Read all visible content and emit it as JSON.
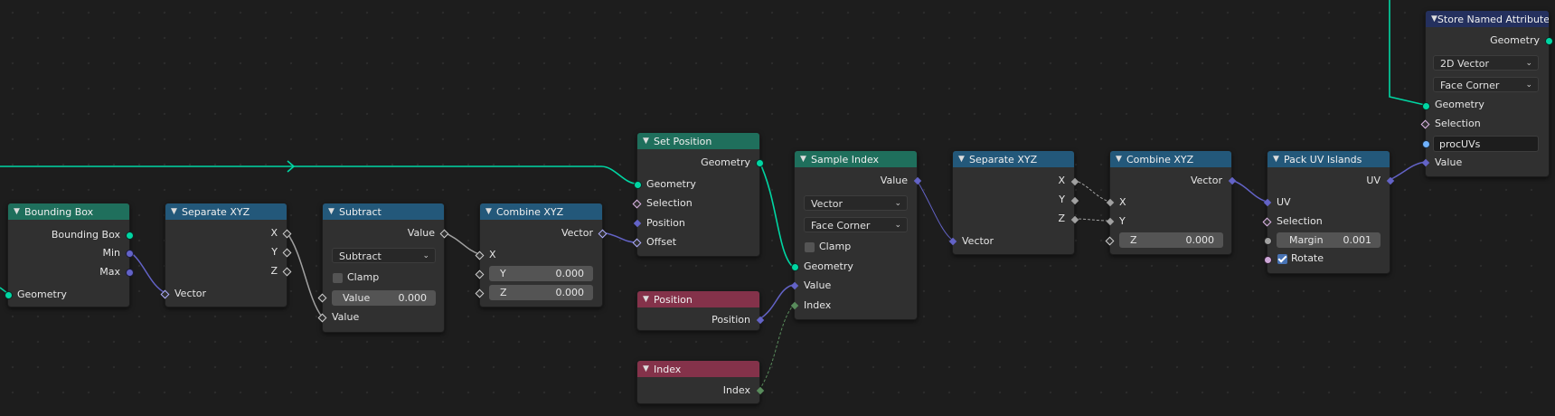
{
  "nodes": {
    "bounding_box": {
      "title": "Bounding Box",
      "out_box": "Bounding Box",
      "out_min": "Min",
      "out_max": "Max",
      "in_geometry": "Geometry"
    },
    "separate_xyz_1": {
      "title": "Separate XYZ",
      "out_x": "X",
      "out_y": "Y",
      "out_z": "Z",
      "in_vector": "Vector"
    },
    "subtract": {
      "title": "Subtract",
      "out_value": "Value",
      "mode": "Subtract",
      "clamp_label": "Clamp",
      "clamp_checked": false,
      "value_label": "Value",
      "value": "0.000",
      "in_value": "Value"
    },
    "combine_xyz_1": {
      "title": "Combine XYZ",
      "out_vector": "Vector",
      "in_x": "X",
      "y_label": "Y",
      "y_value": "0.000",
      "z_label": "Z",
      "z_value": "0.000"
    },
    "set_position": {
      "title": "Set Position",
      "out_geometry": "Geometry",
      "in_geometry": "Geometry",
      "in_selection": "Selection",
      "in_position": "Position",
      "in_offset": "Offset"
    },
    "position": {
      "title": "Position",
      "out_position": "Position"
    },
    "index": {
      "title": "Index",
      "out_index": "Index"
    },
    "sample_index": {
      "title": "Sample Index",
      "out_value": "Value",
      "data_type": "Vector",
      "domain": "Face Corner",
      "clamp_label": "Clamp",
      "clamp_checked": false,
      "in_geometry": "Geometry",
      "in_value": "Value",
      "in_index": "Index"
    },
    "separate_xyz_2": {
      "title": "Separate XYZ",
      "out_x": "X",
      "out_y": "Y",
      "out_z": "Z",
      "in_vector": "Vector"
    },
    "combine_xyz_2": {
      "title": "Combine XYZ",
      "out_vector": "Vector",
      "in_x": "X",
      "in_y": "Y",
      "z_label": "Z",
      "z_value": "0.000"
    },
    "pack_uv_islands": {
      "title": "Pack UV Islands",
      "out_uv": "UV",
      "in_uv": "UV",
      "in_selection": "Selection",
      "margin_label": "Margin",
      "margin_value": "0.001",
      "rotate_label": "Rotate",
      "rotate_checked": true
    },
    "store_named_attribute": {
      "title": "Store Named Attribute",
      "out_geometry": "Geometry",
      "data_type": "2D Vector",
      "domain": "Face Corner",
      "in_geometry": "Geometry",
      "in_selection": "Selection",
      "name_value": "procUVs",
      "in_value": "Value"
    }
  },
  "colors": {
    "geometry_socket": "#00d6a3",
    "vector_socket": "#6363c7",
    "float_socket": "#a1a1a1",
    "int_socket": "#598c5c",
    "header_green": "#1f6f5c",
    "header_blue": "#23587a",
    "header_red": "#84324a",
    "header_navy": "#24305e",
    "background": "#1d1d1d"
  }
}
